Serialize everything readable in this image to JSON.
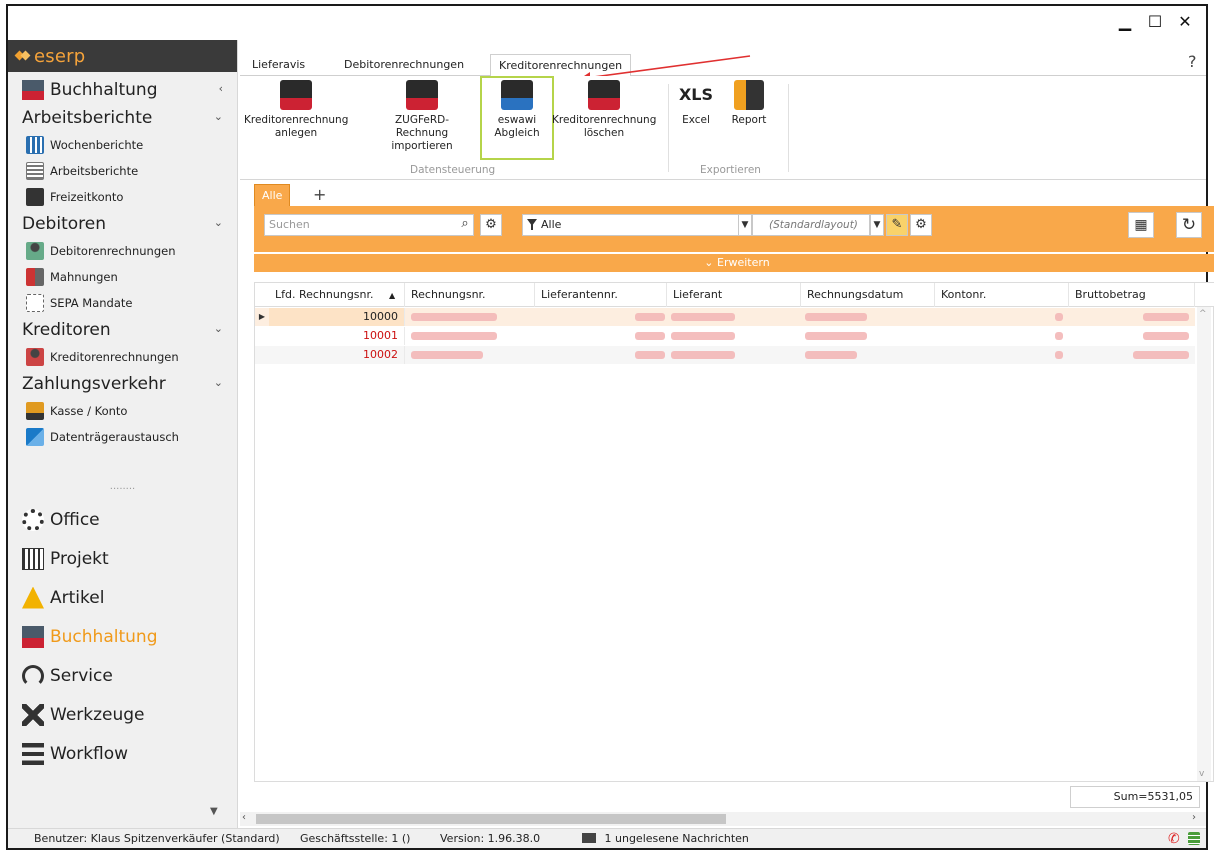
{
  "window": {
    "controls": {
      "minimize": "▁",
      "maximize": "☐",
      "close": "✕"
    },
    "help": "?"
  },
  "sidebar": {
    "brand": "eserp",
    "sections": [
      {
        "label": "Buchhaltung",
        "chevron": "‹"
      },
      {
        "label": "Arbeitsberichte",
        "chevron": "⌄",
        "items": [
          "Wochenberichte",
          "Arbeitsberichte",
          "Freizeitkonto"
        ]
      },
      {
        "label": "Debitoren",
        "chevron": "⌄",
        "items": [
          "Debitorenrechnungen",
          "Mahnungen",
          "SEPA Mandate"
        ]
      },
      {
        "label": "Kreditoren",
        "chevron": "⌄",
        "items": [
          "Kreditorenrechnungen"
        ]
      },
      {
        "label": "Zahlungsverkehr",
        "chevron": "⌄",
        "items": [
          "Kasse / Konto",
          "Datenträgeraustausch"
        ]
      }
    ],
    "dots": "........",
    "modules": [
      "Office",
      "Projekt",
      "Artikel",
      "Buchhaltung",
      "Service",
      "Werkzeuge",
      "Workflow"
    ],
    "active_module": "Buchhaltung"
  },
  "ribbon": {
    "tabs": [
      "Lieferavis",
      "Debitorenrechnungen",
      "Kreditorenrechnungen"
    ],
    "active_tab": "Kreditorenrechnungen",
    "groups": [
      {
        "label": "Datensteuerung",
        "buttons": [
          {
            "line1": "Kreditorenrechnung",
            "line2": "anlegen"
          },
          {
            "line1": "ZUGFeRD-Rechnung",
            "line2": "importieren"
          },
          {
            "line1": "eswawi",
            "line2": "Abgleich"
          },
          {
            "line1": "Kreditorenrechnung",
            "line2": "löschen"
          }
        ]
      },
      {
        "label": "Exportieren",
        "buttons": [
          {
            "line1": "XLS",
            "line2": "Excel"
          },
          {
            "line1": "",
            "line2": "Report"
          }
        ]
      }
    ]
  },
  "view": {
    "tabs": [
      "Alle"
    ],
    "add_tab": "+",
    "search_placeholder": "Suchen",
    "filter": "Alle",
    "layout": "(Standardlayout)",
    "expand": "Erweitern"
  },
  "grid": {
    "columns": [
      "Lfd. Rechnungsnr.",
      "Rechnungsnr.",
      "Lieferantennr.",
      "Lieferant",
      "Rechnungsdatum",
      "Kontonr.",
      "Bruttobetrag"
    ],
    "rows": [
      {
        "lfd": "10000"
      },
      {
        "lfd": "10001"
      },
      {
        "lfd": "10002"
      }
    ],
    "sum": "Sum=5531,05"
  },
  "status": {
    "user": "Benutzer: Klaus Spitzenverkäufer (Standard)",
    "branch": "Geschäftsstelle: 1 ()",
    "version": "Version: 1.96.38.0",
    "messages": "1 ungelesene Nachrichten"
  },
  "colors": {
    "accent": "#f9a84a",
    "brand": "#f5a33a",
    "highlight_border": "#b5d44a",
    "row_number_red": "#cc1111"
  }
}
